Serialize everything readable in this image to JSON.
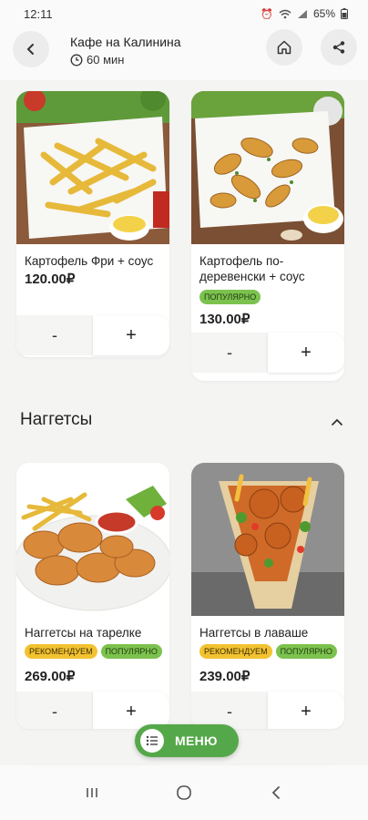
{
  "status_bar": {
    "time": "12:11",
    "battery": "65%",
    "icons": [
      "alarm-icon",
      "wifi-icon",
      "signal-icon",
      "battery-icon"
    ]
  },
  "header": {
    "title": "Кафе на Калинина",
    "delivery_time": "60 мин",
    "icons": [
      "back-arrow-icon",
      "clock-icon",
      "home-icon",
      "share-icon"
    ]
  },
  "products_top": [
    {
      "name": "Картофель Фри + соус",
      "price": "120.00₽",
      "badges": [],
      "minus": "-",
      "plus": "+"
    },
    {
      "name": "Картофель по-деревенски + соус",
      "price": "130.00₽",
      "badges": [
        {
          "label": "популярно",
          "color": "#7cc24e"
        }
      ],
      "minus": "-",
      "plus": "+"
    }
  ],
  "section": {
    "title": "Наггетсы",
    "icon": "chevron-up-icon"
  },
  "products_bottom": [
    {
      "name": "Наггетсы на тарелке",
      "price": "269.00₽",
      "badges": [
        {
          "label": "рекомендуем",
          "color": "#f2c230"
        },
        {
          "label": "популярно",
          "color": "#7cc24e"
        }
      ],
      "minus": "-",
      "plus": "+"
    },
    {
      "name": "Наггетсы в лаваше",
      "price": "239.00₽",
      "badges": [
        {
          "label": "рекомендуем",
          "color": "#f2c230"
        },
        {
          "label": "популярно",
          "color": "#7cc24e"
        }
      ],
      "minus": "-",
      "plus": "+"
    }
  ],
  "menu_button": {
    "label": "МЕНЮ",
    "color": "#55a849",
    "icon": "list-icon"
  },
  "nav_bar": {
    "icons": [
      "recent-apps-icon",
      "home-circle-icon",
      "back-chevron-icon"
    ]
  }
}
